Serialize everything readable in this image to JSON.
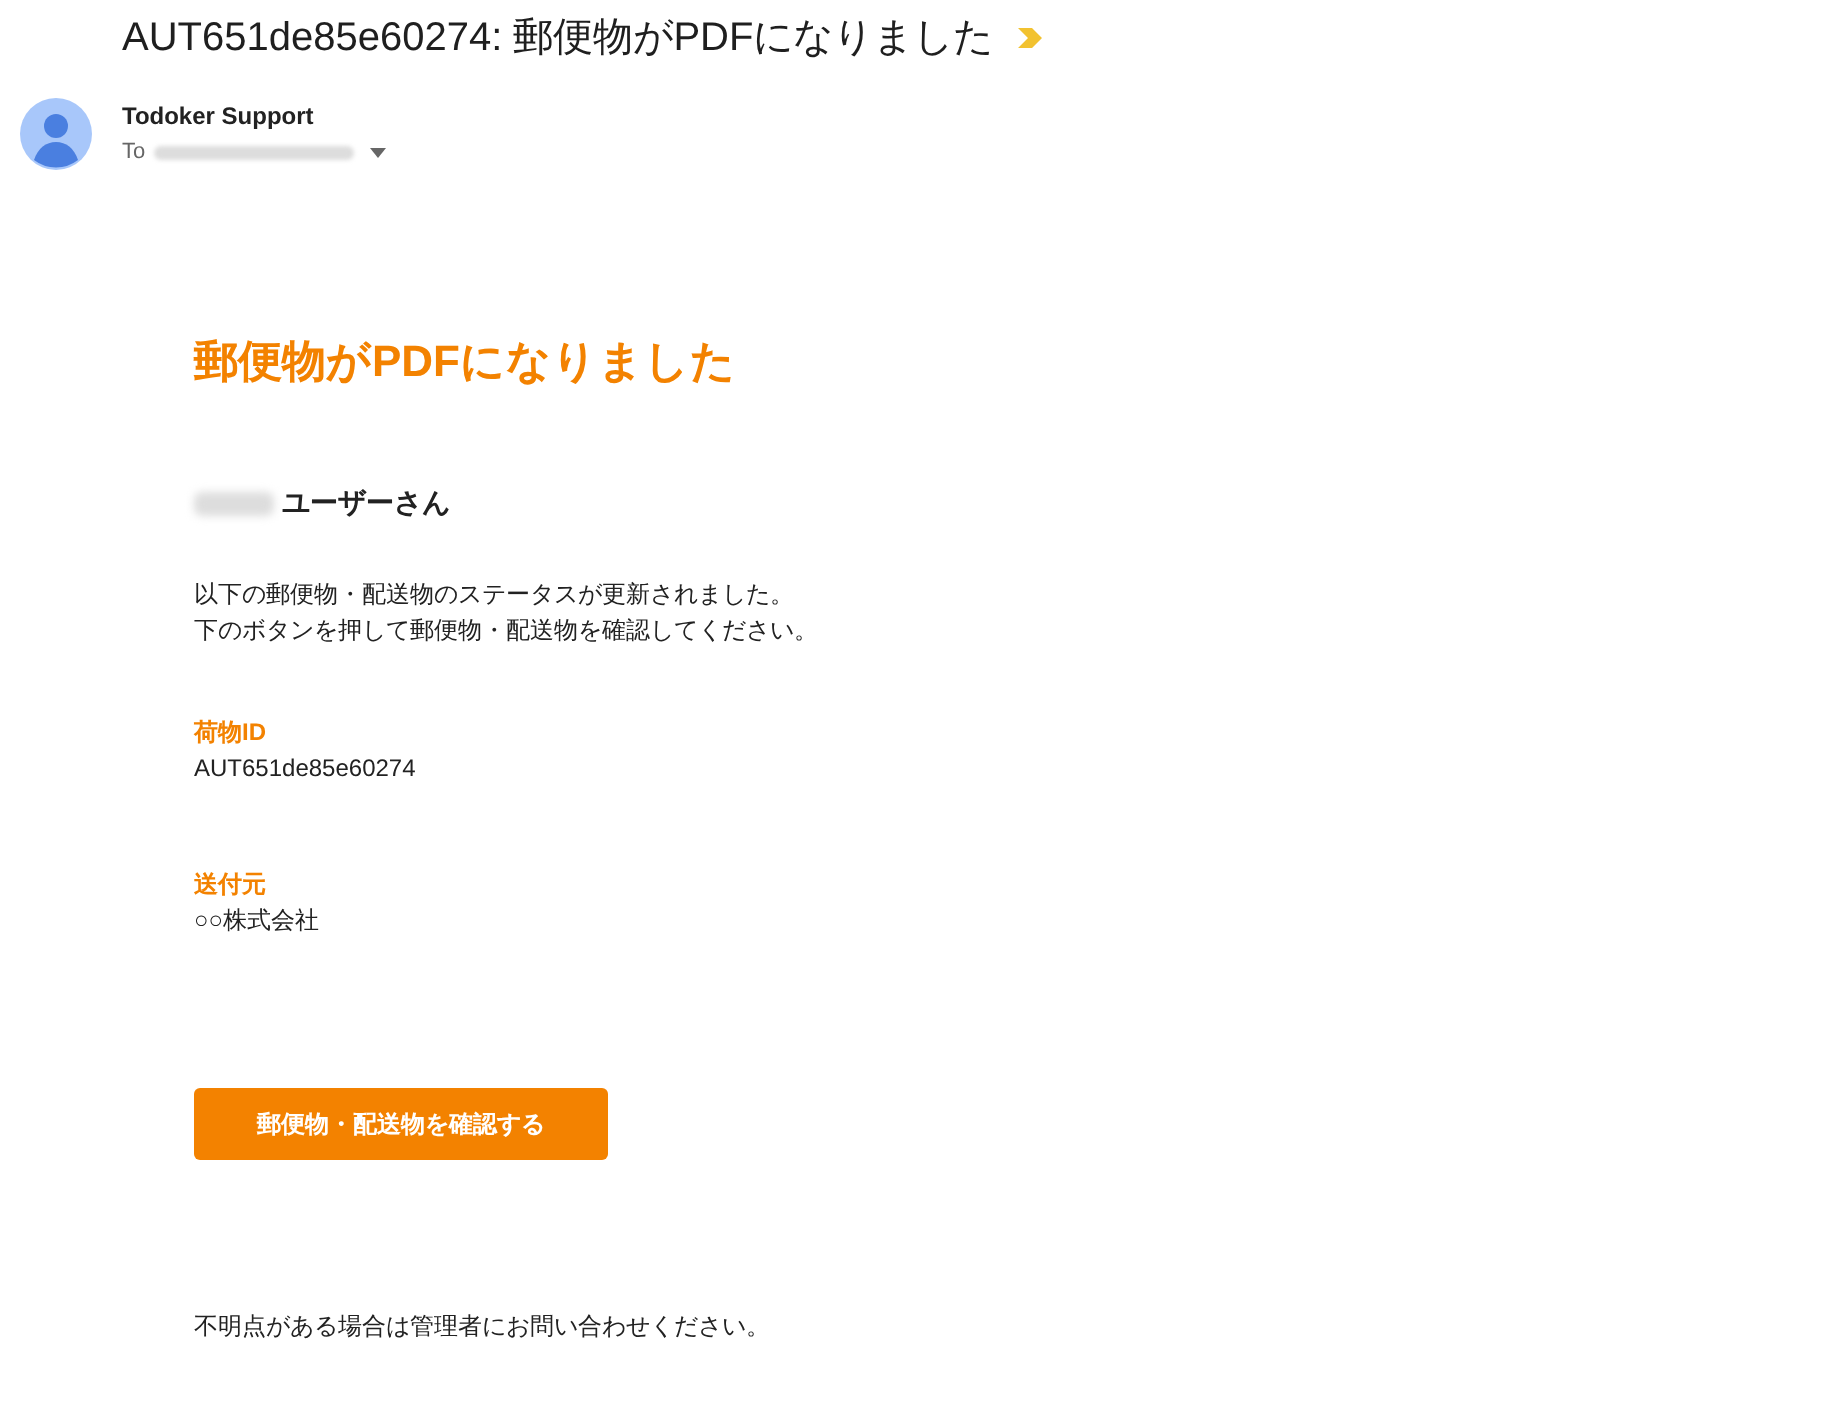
{
  "subject": "AUT651de85e60274: 郵便物がPDFになりました",
  "important": true,
  "sender": {
    "name": "Todoker Support",
    "to_label": "To"
  },
  "email": {
    "heading": "郵便物がPDFになりました",
    "greeting": "ユーザーさん",
    "message": [
      "以下の郵便物・配送物のステータスが更新されました。",
      "下のボタンを押して郵便物・配送物を確認してください。"
    ],
    "fields": [
      {
        "label": "荷物ID",
        "value": "AUT651de85e60274"
      },
      {
        "label": "送付元",
        "value": "○○株式会社"
      }
    ],
    "button": "郵便物・配送物を確認する",
    "footer": "不明点がある場合は管理者にお問い合わせください。"
  }
}
